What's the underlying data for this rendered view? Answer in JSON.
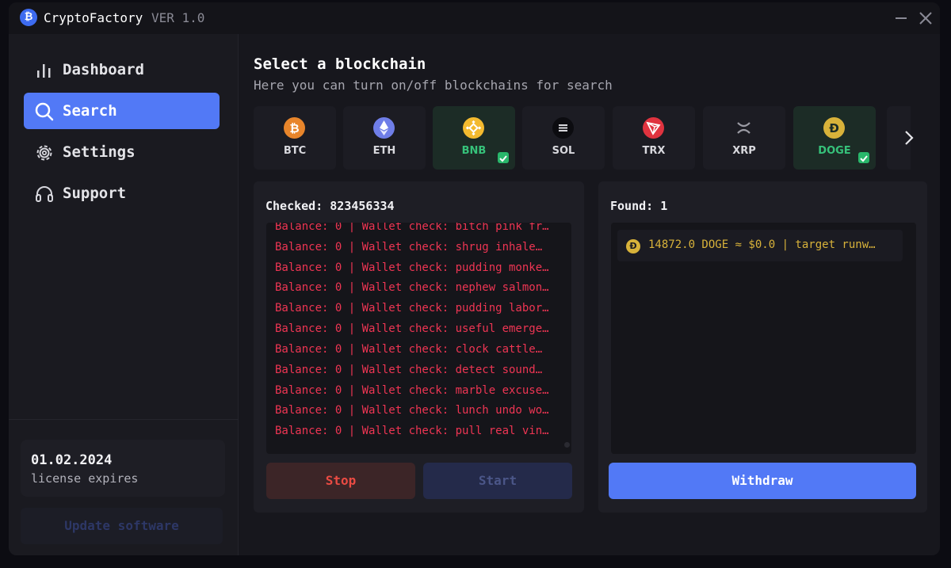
{
  "window": {
    "app_name": "CryptoFactory",
    "version": "VER 1.0"
  },
  "sidebar": {
    "items": [
      {
        "label": "Dashboard",
        "icon": "bar-chart-icon"
      },
      {
        "label": "Search",
        "icon": "search-icon",
        "active": true
      },
      {
        "label": "Settings",
        "icon": "gear-icon"
      },
      {
        "label": "Support",
        "icon": "headset-icon"
      }
    ],
    "license_date": "01.02.2024",
    "license_label": "license expires",
    "update_label": "Update software"
  },
  "main": {
    "title": "Select a blockchain",
    "subtitle": "Here you can turn on/off blockchains for search"
  },
  "chains": [
    {
      "label": "BTC",
      "selected": false,
      "color": "#e8852b"
    },
    {
      "label": "ETH",
      "selected": false,
      "color": "#6f7ee8"
    },
    {
      "label": "BNB",
      "selected": true,
      "color": "#f3ba2f"
    },
    {
      "label": "SOL",
      "selected": false,
      "color": "#0c0c10"
    },
    {
      "label": "TRX",
      "selected": false,
      "color": "#e0333f"
    },
    {
      "label": "XRP",
      "selected": false,
      "color": "#9a9aa3"
    },
    {
      "label": "DOGE",
      "selected": true,
      "color": "#d8b23a"
    }
  ],
  "search": {
    "checked_label": "Checked: 823456334",
    "log_lines": [
      "Balance: 0 | Wallet check: bitch pink fr…",
      "Balance: 0 | Wallet check: shrug inhale…",
      "Balance: 0 | Wallet check: pudding monke…",
      "Balance: 0 | Wallet check: nephew salmon…",
      "Balance: 0 | Wallet check: pudding labor…",
      "Balance: 0 | Wallet check: useful emerge…",
      "Balance: 0 | Wallet check: clock cattle…",
      "Balance: 0 | Wallet check: detect sound…",
      "Balance: 0 | Wallet check: marble excuse…",
      "Balance: 0 | Wallet check: lunch undo wo…",
      "Balance: 0 | Wallet check: pull real vin…"
    ],
    "stop_label": "Stop",
    "start_label": "Start"
  },
  "found": {
    "label": "Found: 1",
    "items": [
      {
        "text": "14872.0 DOGE ≈ $0.0 | target runw…",
        "icon": "doge-coin-icon",
        "glyph": "Ð"
      }
    ],
    "withdraw_label": "Withdraw"
  },
  "colors": {
    "accent": "#5279f6",
    "log_red": "#ee3553",
    "selected_green": "#36c27a",
    "doge_gold": "#d8b23a"
  }
}
